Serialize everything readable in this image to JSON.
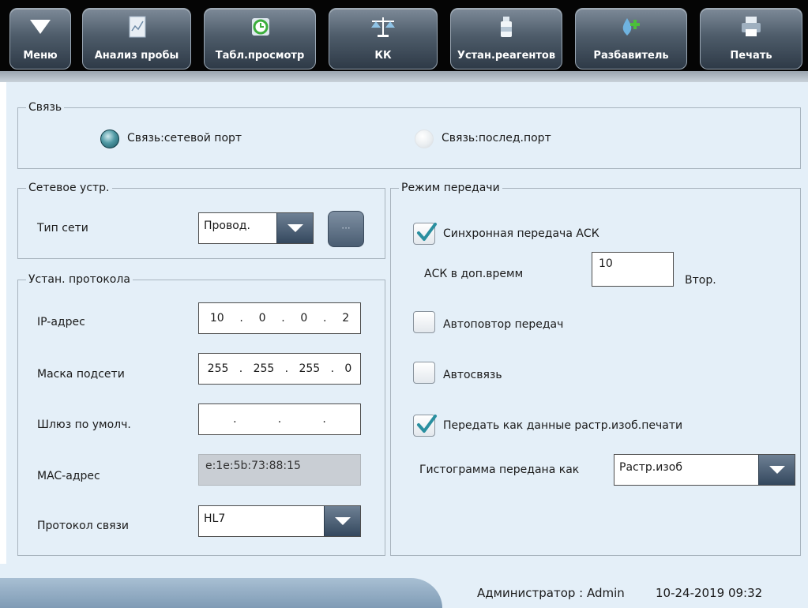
{
  "toolbar": {
    "buttons": [
      {
        "label": "Меню",
        "icon": "menu-triangle-icon"
      },
      {
        "label": "Анализ пробы",
        "icon": "sample-analysis-icon"
      },
      {
        "label": "Табл.просмотр",
        "icon": "table-review-icon"
      },
      {
        "label": "КК",
        "icon": "scales-icon"
      },
      {
        "label": "Устан.реагентов",
        "icon": "reagent-bottle-icon"
      },
      {
        "label": "Разбавитель",
        "icon": "diluent-drop-icon"
      },
      {
        "label": "Печать",
        "icon": "printer-icon"
      }
    ]
  },
  "connection": {
    "legend": "Связь",
    "network_port": {
      "label": "Связь:сетевой порт",
      "selected": true
    },
    "serial_port": {
      "label": "Связь:послед.порт",
      "selected": false
    }
  },
  "network_device": {
    "legend": "Сетевое устр.",
    "network_type_label": "Тип сети",
    "network_type_value": "Провод.",
    "more_button": "···"
  },
  "protocol": {
    "legend": "Устан. протокола",
    "ip_label": "IP-адрес",
    "ip": [
      "10",
      "0",
      "0",
      "2"
    ],
    "mask_label": "Маска подсети",
    "mask": [
      "255",
      "255",
      "255",
      "0"
    ],
    "gateway_label": "Шлюз по умолч.",
    "gateway": [
      "",
      "",
      "",
      ""
    ],
    "mac_label": "MAC-адрес",
    "mac_value": "e:1e:5b:73:88:15",
    "comm_protocol_label": "Протокол связи",
    "comm_protocol_value": "HL7"
  },
  "transfer": {
    "legend": "Режим передачи",
    "sync_ack": {
      "label": "Синхронная передача АСК",
      "checked": true
    },
    "ack_time_label": "АСК в доп.времм",
    "ack_time_value": "10",
    "ack_time_unit": "Втор.",
    "auto_retry": {
      "label": "Автоповтор передач",
      "checked": false
    },
    "auto_connect": {
      "label": "Автосвязь",
      "checked": false
    },
    "send_bitmap": {
      "label": "Передать как данные растр.изоб.печати",
      "checked": true
    },
    "histogram_label": "Гистограмма передана как",
    "histogram_value": "Растр.изоб"
  },
  "status": {
    "user": "Администратор : Admin",
    "datetime": "10-24-2019 09:32"
  },
  "colors": {
    "toolbar_bg": "#050505",
    "content_bg": "#e4eff8",
    "accent_check": "#2a8fa0"
  }
}
